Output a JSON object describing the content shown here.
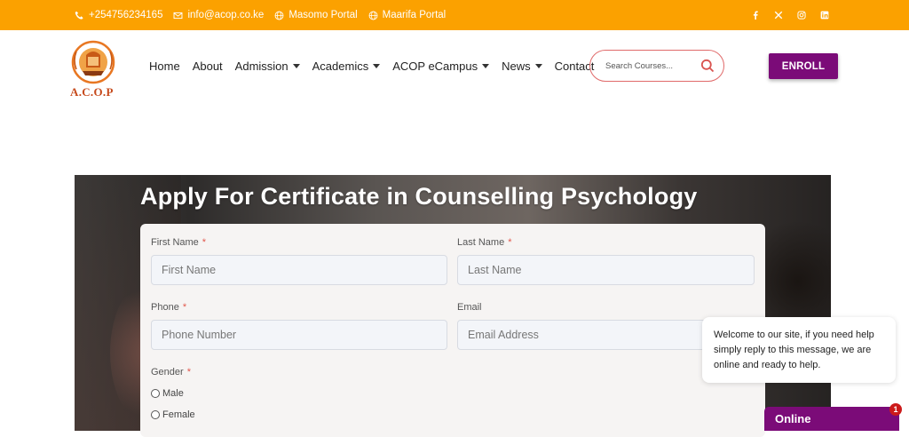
{
  "topbar": {
    "phone": "+254756234165",
    "email": "info@acop.co.ke",
    "links": [
      "Masomo Portal",
      "Maarifa Portal"
    ],
    "socials": [
      "facebook-icon",
      "x-icon",
      "instagram-icon",
      "linkedin-icon"
    ]
  },
  "logo": {
    "text": "A.C.O.P",
    "ring_text": "AFRICAN COLLEGE OF PSYCHOLOGY"
  },
  "nav": {
    "items": [
      {
        "label": "Home",
        "dropdown": false
      },
      {
        "label": "About",
        "dropdown": false
      },
      {
        "label": "Admission",
        "dropdown": true
      },
      {
        "label": "Academics",
        "dropdown": true
      },
      {
        "label": "ACOP eCampus",
        "dropdown": true
      },
      {
        "label": "News",
        "dropdown": true
      },
      {
        "label": "Contact",
        "dropdown": false
      }
    ]
  },
  "search": {
    "placeholder": "Search Courses..."
  },
  "enroll": {
    "label": "ENROLL"
  },
  "form": {
    "title": "Apply For Certificate in Counselling Psychology",
    "first_name": {
      "label": "First Name",
      "placeholder": "First Name",
      "required": "*"
    },
    "last_name": {
      "label": "Last Name",
      "placeholder": "Last Name",
      "required": "*"
    },
    "phone": {
      "label": "Phone",
      "placeholder": "Phone Number",
      "required": "*"
    },
    "email": {
      "label": "Email",
      "placeholder": "Email Address"
    },
    "gender": {
      "label": "Gender",
      "required": "*",
      "options": [
        "Male",
        "Female"
      ]
    }
  },
  "chat": {
    "message": "Welcome to our site, if you need help simply reply to this message, we are online and ready to help.",
    "status": "Online",
    "badge": "1"
  },
  "colors": {
    "topbar": "#FBA100",
    "brand_purple": "#7B0B78",
    "search_border": "#e06a6a",
    "required": "#e2574c"
  }
}
